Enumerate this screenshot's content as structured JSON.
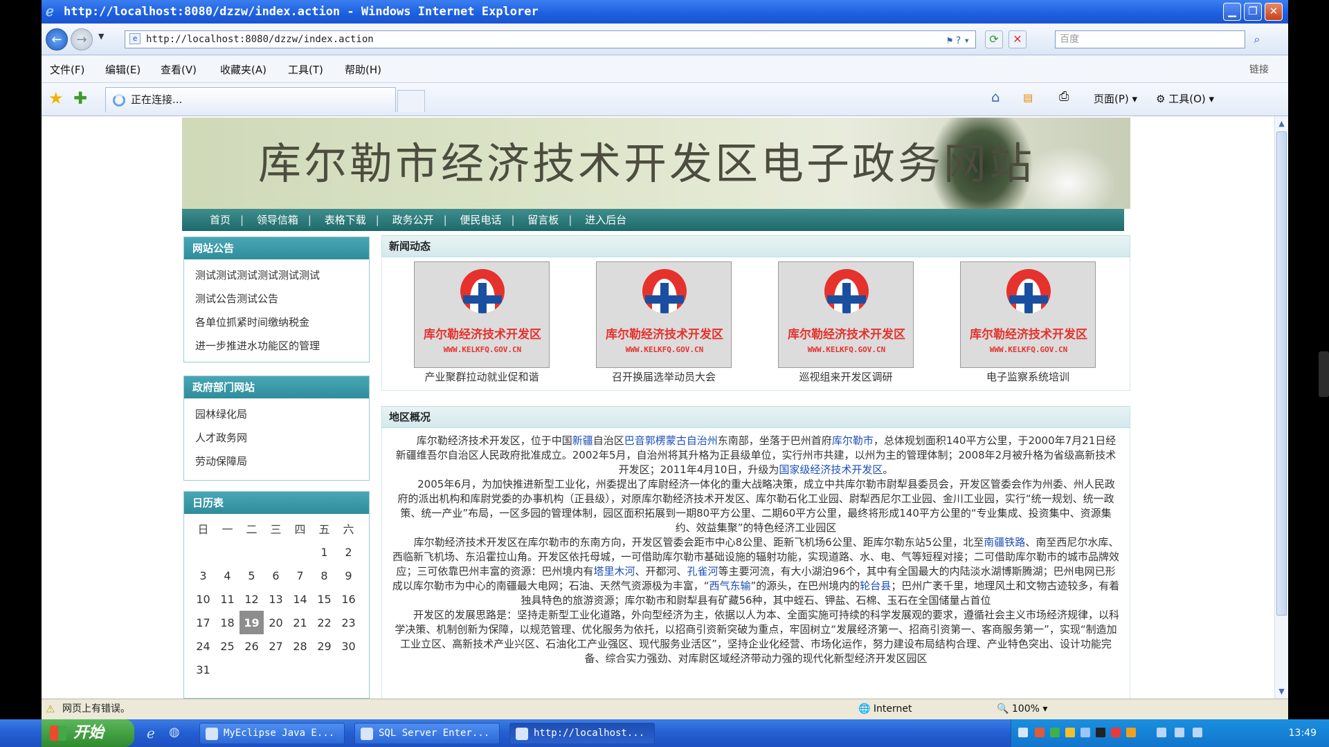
{
  "window": {
    "title": "http://localhost:8080/dzzw/index.action - Windows Internet Explorer",
    "url": "http://localhost:8080/dzzw/index.action",
    "search_placeholder": "百度"
  },
  "menu": [
    "文件(F)",
    "编辑(E)",
    "查看(V)",
    "收藏夹(A)",
    "工具(T)",
    "帮助(H)"
  ],
  "links_label": "链接",
  "tab_label": "正在连接...",
  "commands": {
    "page": "页面(P)",
    "tools": "工具(O)"
  },
  "site": {
    "banner_title": "库尔勒市经济技术开发区电子政务网站",
    "nav": [
      "首页",
      "领导信箱",
      "表格下载",
      "政务公开",
      "便民电话",
      "留言板",
      "进入后台"
    ],
    "notice": {
      "title": "网站公告",
      "items": [
        "测试测试测试测试测试测试",
        "测试公告测试公告",
        "各单位抓紧时间缴纳税金",
        "进一步推进水功能区的管理"
      ]
    },
    "depts": {
      "title": "政府部门网站",
      "items": [
        "园林绿化局",
        "人才政务网",
        "劳动保障局"
      ]
    },
    "calendar": {
      "title": "日历表",
      "weekdays": [
        "日",
        "一",
        "二",
        "三",
        "四",
        "五",
        "六"
      ],
      "weeks": [
        [
          "",
          "",
          "",
          "",
          "",
          "1",
          "2"
        ],
        [
          "3",
          "4",
          "5",
          "6",
          "7",
          "8",
          "9"
        ],
        [
          "10",
          "11",
          "12",
          "13",
          "14",
          "15",
          "16"
        ],
        [
          "17",
          "18",
          "19",
          "20",
          "21",
          "22",
          "23"
        ],
        [
          "24",
          "25",
          "26",
          "27",
          "28",
          "29",
          "30"
        ],
        [
          "31",
          "",
          "",
          "",
          "",
          "",
          ""
        ]
      ],
      "today": "19"
    },
    "news": {
      "title": "新闻动态",
      "logo_text": "库尔勒经济技术开发区",
      "logo_url": "WWW.KELKFQ.GOV.CN",
      "items": [
        "产业聚群拉动就业促和谐",
        "召开换届选举动员大会",
        "巡视组来开发区调研",
        "电子监察系统培训"
      ]
    },
    "area": {
      "title": "地区概况",
      "p1": [
        "库尔勒经济技术开发区，位于中国",
        "新疆",
        "自治区",
        "巴音郭楞蒙古自治州",
        "东南部，坐落于巴州首府",
        "库尔勒市",
        "，总体规划面积140平方公里，于2000年7月21日经新疆维吾尔自治区人民政府批准成立。2002年5月，自治州将其升格为正县级单位，实行州市共建，以州为主的管理体制；2008年2月被升格为省级高新技术开发区；2011年4月10日，升级为",
        "国家级经济技术开发区",
        "。"
      ],
      "p2": "2005年6月，为加快推进新型工业化，州委提出了库尉经济一体化的重大战略决策，成立中共库尔勒市尉犁县委员会，开发区管委会作为州委、州人民政府的派出机构和库尉党委的办事机构（正县级），对原库尔勒经济技术开发区、库尔勒石化工业园、尉犁西尼尔工业园、金川工业园，实行“统一规划、统一政策、统一产业”布局，一区多园的管理体制，园区面积拓展到一期80平方公里、二期60平方公里，最终将形成140平方公里的“专业集成、投资集中、资源集约、效益集聚”的特色经济工业园区",
      "p3": [
        "库尔勒经济技术开发区在库尔勒市的东南方向，开发区管委会距市中心8公里、距新飞机场6公里、距库尔勒东站5公里，北至",
        "南疆铁路",
        "、南至西尼尔水库、西临新飞机场、东沿霍拉山角。开发区依托母城，一可借助库尔勒市基础设施的辐射功能，实现道路、水、电、气等短程对接；二可借助库尔勒市的城市品牌效应；三可依靠巴州丰富的资源：巴州境内有",
        "塔里木河",
        "、开都河、",
        "孔雀河",
        "等主要河流，有大小湖泊96个，其中有全国最大的内陆淡水湖博斯腾湖；巴州电网已形成以库尔勒市为中心的南疆最大电网；石油、天然气资源极为丰富，“",
        "西气东输",
        "”的源头，在巴州境内的",
        "轮台县",
        "；巴州广袤千里，地理风土和文物古迹较多，有着独具特色的旅游资源；库尔勒市和尉犁县有矿藏56种，其中蛭石、钾盐、石棉、玉石在全国储量占首位"
      ],
      "p4": "开发区的发展思路是：坚持走新型工业化道路，外向型经济为主，依据以人为本、全面实施可持续的科学发展观的要求，遵循社会主义市场经济规律，以科学决策、机制创新为保障，以规范管理、优化服务为依托，以招商引资新突破为重点，牢固树立“发展经济第一、招商引资第一、客商服务第一”，实现“制造加工业立区、高新技术产业兴区、石油化工产业强区、现代服务业活区”，坚持企业化经营、市场化运作，努力建设布局结构合理、产业特色突出、设计功能完备、综合实力强劲、对库尉区域经济带动力强的现代化新型经济开发区园区"
    }
  },
  "status": {
    "message": "网页上有错误。",
    "zone": "Internet",
    "zoom": "100%"
  },
  "taskbar": {
    "start": "开始",
    "items": [
      "MyEclipse Java E...",
      "SQL Server Enter...",
      "http://localhost..."
    ],
    "clock": "13:49"
  }
}
